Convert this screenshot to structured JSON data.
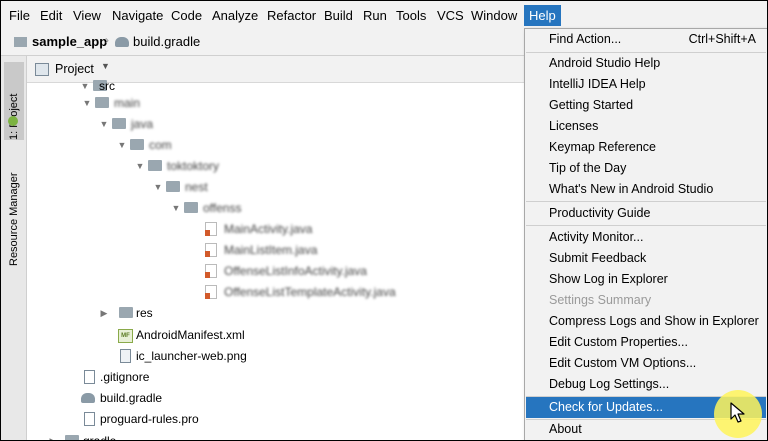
{
  "menubar": {
    "items": [
      "File",
      "Edit",
      "View",
      "Navigate",
      "Code",
      "Analyze",
      "Refactor",
      "Build",
      "Run",
      "Tools",
      "VCS",
      "Window",
      "Help"
    ],
    "active": "Help"
  },
  "breadcrumb": {
    "project": "sample_app",
    "file": "build.gradle"
  },
  "toolstrip": {
    "project_tab": "1: Project",
    "resource_tab": "Resource Manager"
  },
  "panel": {
    "title": "Project"
  },
  "tree": {
    "src": "src",
    "main": "main",
    "java": "java",
    "com": "com",
    "pkg1": "toktoktory",
    "pkg2": "nest",
    "pkg3": "offenss",
    "file1": "MainActivity.java",
    "file2": "MainListItem.java",
    "file3": "OffenseListInfoActivity.java",
    "file4": "OffenseListTemplateActivity.java",
    "res": "res",
    "manifest": "AndroidManifest.xml",
    "launcher": "ic_launcher-web.png",
    "gitignore": ".gitignore",
    "build_gradle": "build.gradle",
    "proguard": "proguard-rules.pro",
    "gradle": "gradle"
  },
  "help_menu": {
    "find_action": "Find Action...",
    "find_action_shortcut": "Ctrl+Shift+A",
    "android_studio_help": "Android Studio Help",
    "intellij_help": "IntelliJ IDEA Help",
    "getting_started": "Getting Started",
    "licenses": "Licenses",
    "keymap_reference": "Keymap Reference",
    "tip_of_the_day": "Tip of the Day",
    "whats_new": "What's New in Android Studio",
    "productivity_guide": "Productivity Guide",
    "activity_monitor": "Activity Monitor...",
    "submit_feedback": "Submit Feedback",
    "show_log": "Show Log in Explorer",
    "settings_summary": "Settings Summary",
    "compress_logs": "Compress Logs and Show in Explorer",
    "edit_custom_properties": "Edit Custom Properties...",
    "edit_custom_vm": "Edit Custom VM Options...",
    "debug_log_settings": "Debug Log Settings...",
    "check_for_updates": "Check for Updates...",
    "about": "About"
  },
  "colors": {
    "accent": "#2675bf",
    "menu_bg": "#f2f2f2",
    "disabled": "#9a9a9a",
    "cursor_highlight": "#fff55a"
  }
}
